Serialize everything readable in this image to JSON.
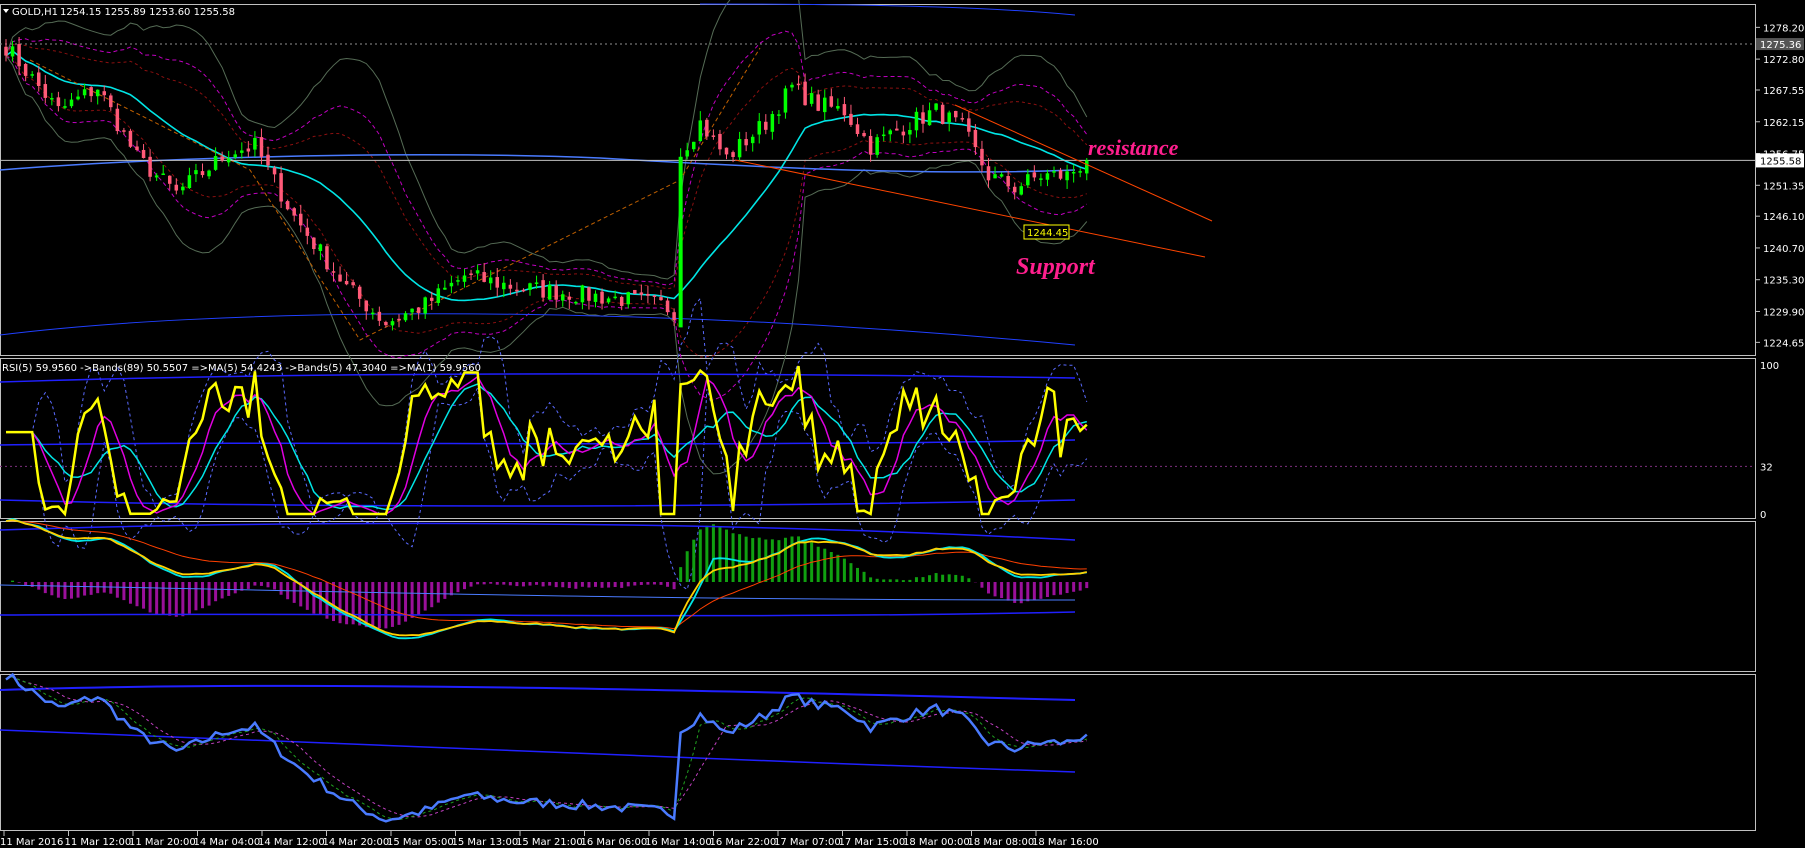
{
  "header": {
    "symbol": "GOLD,H1",
    "ohlc": "1254.15 1255.89 1253.60 1255.58"
  },
  "rsi_header": "RSI(5) 59.9560  ->Bands(89) 50.5507  =>MA(5) 54.4243  ->Bands(5) 47.3040  =>MA(1) 59.9560",
  "annotations": {
    "resistance": "resistance",
    "support": "Support",
    "support_price": "1244.45"
  },
  "colors": {
    "bull": "#00ff00",
    "bear": "#ff5a78",
    "rsi": "#ffff00",
    "ma_cyan": "#00e5e5",
    "bands": "#1a1aff",
    "annotation": "#ff1f8e",
    "trend": "#ff4500"
  },
  "chart_data": [
    {
      "type": "candlestick",
      "title": "GOLD,H1",
      "ylim": [
        1222.5,
        1282
      ],
      "price_ticks": [
        "1278.20",
        "1272.80",
        "1267.55",
        "1262.15",
        "1256.75",
        "1251.35",
        "1246.10",
        "1240.70",
        "1235.30",
        "1229.90",
        "1224.65"
      ],
      "current_price": "1255.58",
      "dotted_level": "1275.36",
      "x_labels": [
        "11 Mar 2016",
        "11 Mar 12:00",
        "11 Mar 20:00",
        "14 Mar 04:00",
        "14 Mar 12:00",
        "14 Mar 20:00",
        "15 Mar 05:00",
        "15 Mar 13:00",
        "15 Mar 21:00",
        "16 Mar 06:00",
        "16 Mar 14:00",
        "16 Mar 22:00",
        "17 Mar 07:00",
        "17 Mar 15:00",
        "18 Mar 00:00",
        "18 Mar 08:00",
        "18 Mar 16:00"
      ],
      "close_keypoints": [
        [
          0,
          1275
        ],
        [
          8,
          1264
        ],
        [
          14,
          1268
        ],
        [
          20,
          1256
        ],
        [
          26,
          1250
        ],
        [
          34,
          1257
        ],
        [
          38,
          1258
        ],
        [
          44,
          1246
        ],
        [
          52,
          1234
        ],
        [
          58,
          1228
        ],
        [
          64,
          1231
        ],
        [
          70,
          1236
        ],
        [
          78,
          1234
        ],
        [
          86,
          1233
        ],
        [
          94,
          1232
        ],
        [
          100,
          1231
        ],
        [
          102,
          1230
        ],
        [
          103,
          1257
        ],
        [
          106,
          1262
        ],
        [
          110,
          1256
        ],
        [
          116,
          1262
        ],
        [
          120,
          1268
        ],
        [
          124,
          1265
        ],
        [
          128,
          1264
        ],
        [
          132,
          1258
        ],
        [
          138,
          1262
        ],
        [
          142,
          1264
        ],
        [
          146,
          1261
        ],
        [
          150,
          1253
        ],
        [
          154,
          1251
        ],
        [
          158,
          1253
        ],
        [
          162,
          1253
        ],
        [
          165,
          1255.58
        ]
      ]
    },
    {
      "type": "line",
      "title": "RSI(5)",
      "ylim": [
        0,
        100
      ],
      "levels": [
        "100",
        "32",
        "0"
      ],
      "series": [
        {
          "name": "RSI(5)",
          "current": 59.956
        }
      ]
    },
    {
      "type": "histogram",
      "title": ""
    },
    {
      "type": "line",
      "title": ""
    }
  ]
}
